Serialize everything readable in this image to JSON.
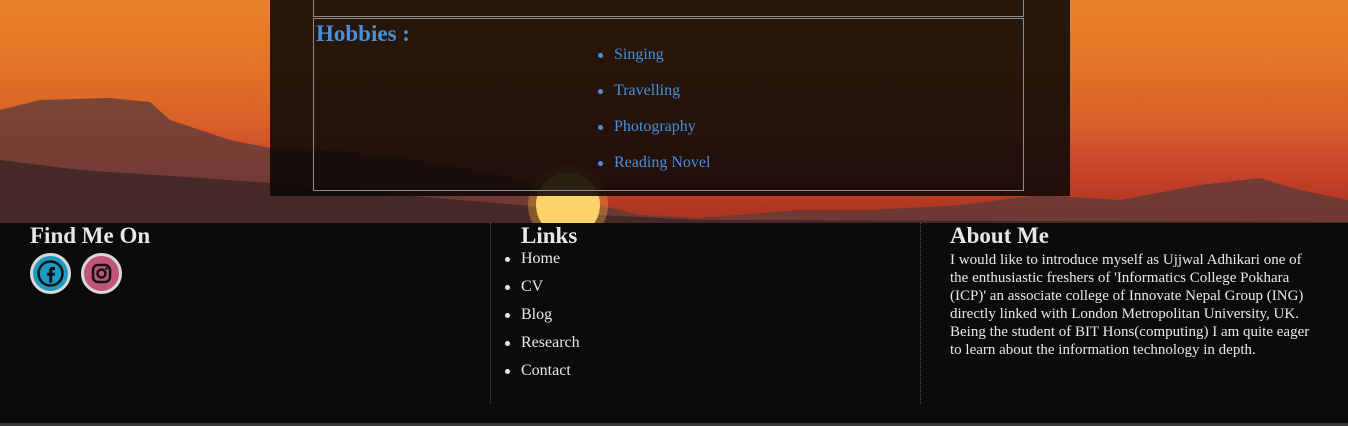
{
  "hobbies": {
    "title": "Hobbies :",
    "items": [
      "Singing",
      "Travelling",
      "Photography",
      "Reading Novel"
    ]
  },
  "footer": {
    "find_me": {
      "title": "Find Me On",
      "icons": [
        "facebook-icon",
        "instagram-icon"
      ]
    },
    "links": {
      "title": "Links",
      "items": [
        "Home",
        "CV",
        "Blog",
        "Research",
        "Contact"
      ]
    },
    "about": {
      "title": "About Me",
      "text": "I would like to introduce myself as Ujjwal Adhikari one of the enthusiastic freshers of 'Informatics College Pokhara (ICP)' an associate college of Innovate Nepal Group (ING) directly linked with London Metropolitan University, UK. Being the student of BIT Hons(computing) I am quite eager to learn about the information technology in depth."
    }
  },
  "colors": {
    "accent_blue": "#4a90d9",
    "footer_bg": "#0b0b0b",
    "facebook": "#1b9bc4",
    "instagram": "#c0547a"
  }
}
